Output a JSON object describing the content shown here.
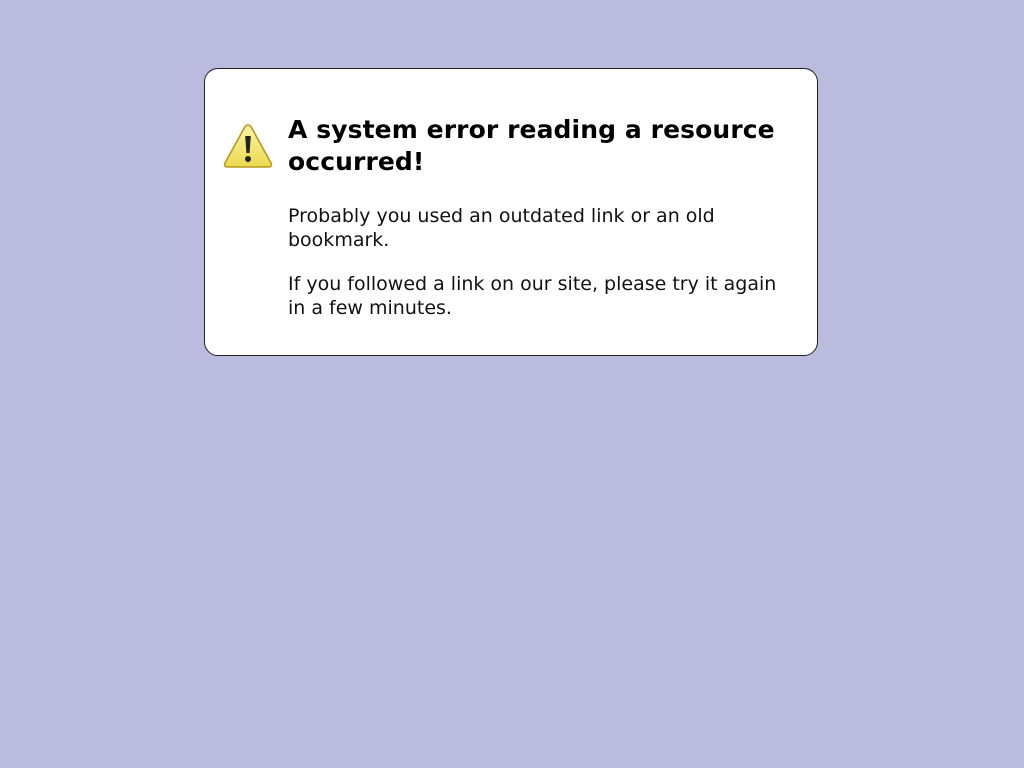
{
  "error": {
    "icon": "warning-icon",
    "icon_colors": {
      "fill": "#f6ea7a",
      "stroke": "#b59a1c",
      "mark": "#222222"
    },
    "title": "A system error reading a resource occurred!",
    "paragraphs": [
      "Probably you used an outdated link or an old bookmark.",
      "If you followed a link on our site, please try it again in a few minutes."
    ]
  },
  "colors": {
    "page_background": "#babbde",
    "box_background": "#ffffff",
    "box_border": "#222222"
  }
}
